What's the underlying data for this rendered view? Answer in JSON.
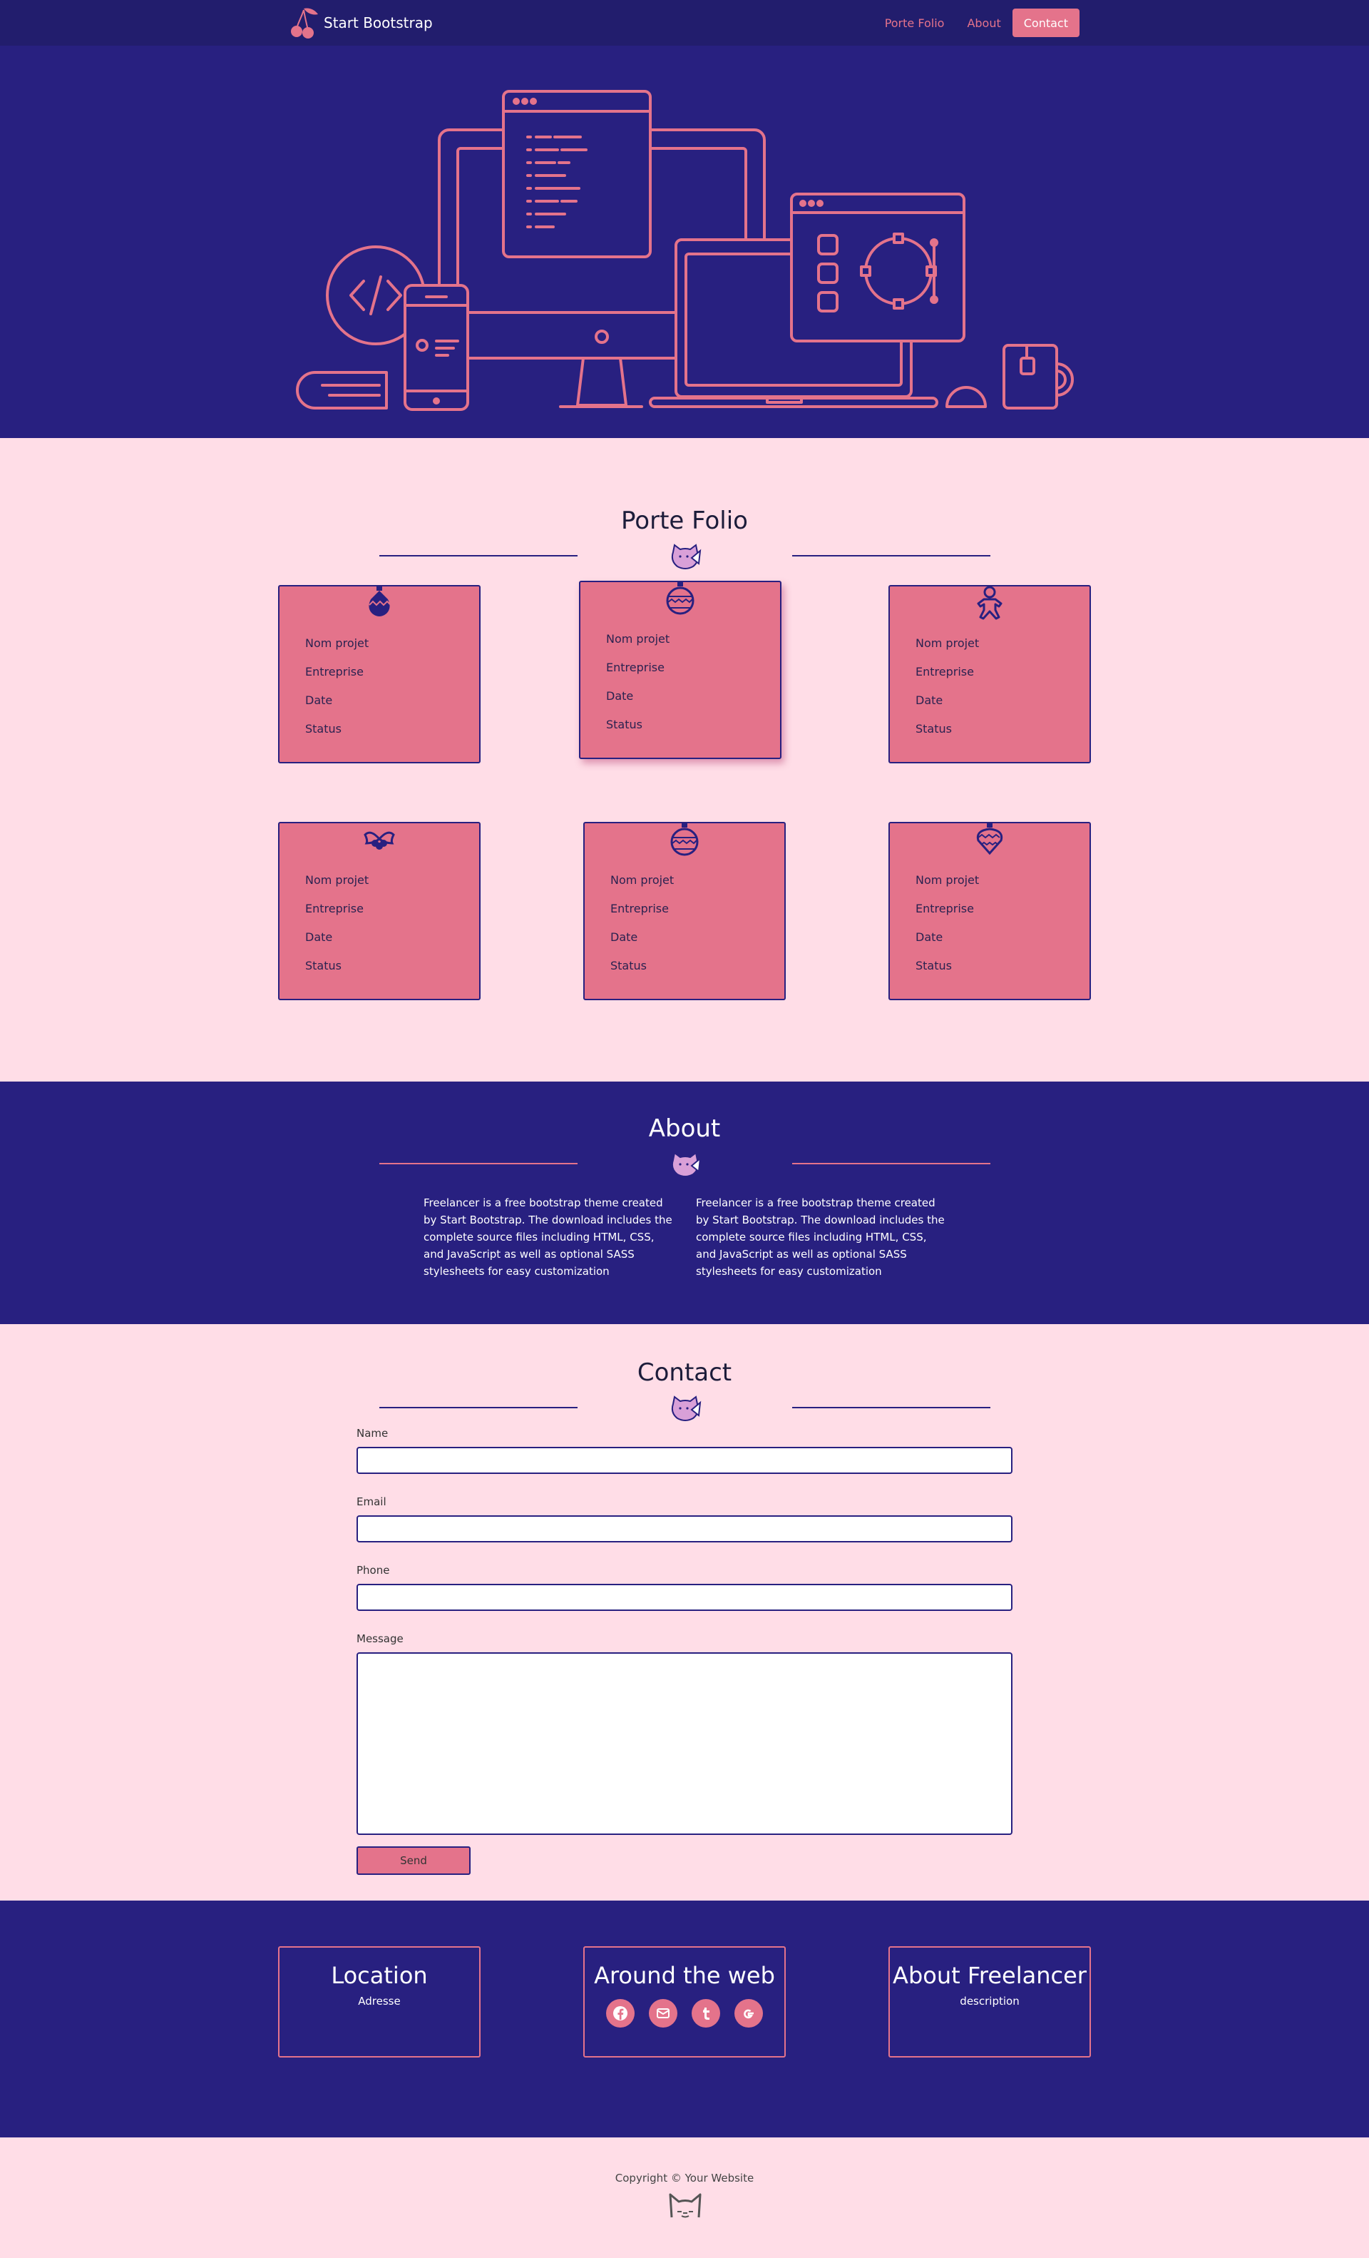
{
  "nav": {
    "brand": "Start Bootstrap",
    "links": [
      "Porte Folio",
      "About"
    ],
    "cta": "Contact"
  },
  "colors": {
    "navy": "#221d6d",
    "indigo": "#282080",
    "pink": "#e4738b",
    "blush": "#ffdde7"
  },
  "portfolio": {
    "title": "Porte Folio",
    "cards": [
      {
        "icon": "ornament-zigzag-icon",
        "fields": [
          "Nom projet",
          "Entreprise",
          "Date",
          "Status"
        ]
      },
      {
        "icon": "ornament-ball-icon",
        "fields": [
          "Nom projet",
          "Entreprise",
          "Date",
          "Status"
        ]
      },
      {
        "icon": "gingerbread-icon",
        "fields": [
          "Nom projet",
          "Entreprise",
          "Date",
          "Status"
        ]
      },
      {
        "icon": "holly-icon",
        "fields": [
          "Nom projet",
          "Entreprise",
          "Date",
          "Status"
        ]
      },
      {
        "icon": "ornament-ball-icon",
        "fields": [
          "Nom projet",
          "Entreprise",
          "Date",
          "Status"
        ]
      },
      {
        "icon": "ornament-heart-icon",
        "fields": [
          "Nom projet",
          "Entreprise",
          "Date",
          "Status"
        ]
      }
    ]
  },
  "about": {
    "title": "About",
    "paragraphs": [
      "Freelancer is a free bootstrap theme created by Start Bootstrap. The download includes the complete source files including HTML, CSS, and JavaScript as well as optional SASS stylesheets for easy customization",
      "Freelancer is a free bootstrap theme created by Start Bootstrap. The download includes the complete source files including HTML, CSS, and JavaScript as well as optional SASS stylesheets for easy customization"
    ]
  },
  "contact": {
    "title": "Contact",
    "fields": [
      "Name",
      "Email",
      "Phone",
      "Message"
    ],
    "send": "Send"
  },
  "footer": {
    "location": {
      "title": "Location",
      "text": "Adresse"
    },
    "web": {
      "title": "Around the web",
      "icons": [
        "facebook-icon",
        "mail-icon",
        "tumblr-icon",
        "google-icon"
      ]
    },
    "aboutf": {
      "title": "About Freelancer",
      "text": "description"
    }
  },
  "copyright": "Copyright © Your Website"
}
